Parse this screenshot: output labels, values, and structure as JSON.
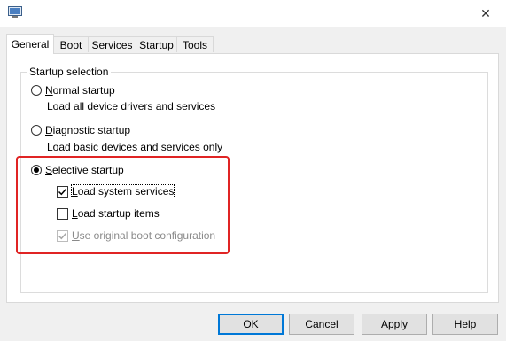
{
  "window": {
    "app_icon": "msconfig-icon",
    "close_glyph": "✕"
  },
  "tabs": [
    {
      "label": "General",
      "active": true
    },
    {
      "label": "Boot"
    },
    {
      "label": "Services"
    },
    {
      "label": "Startup"
    },
    {
      "label": "Tools"
    }
  ],
  "startup_selection": {
    "title": "Startup selection",
    "normal": {
      "label_mnemonic": "N",
      "label_rest": "ormal startup",
      "description": "Load all device drivers and services",
      "selected": false
    },
    "diagnostic": {
      "label_mnemonic": "D",
      "label_rest": "iagnostic startup",
      "description": "Load basic devices and services only",
      "selected": false
    },
    "selective": {
      "label_mnemonic": "S",
      "label_rest": "elective startup",
      "selected": true,
      "options": {
        "load_system_services": {
          "mnemonic": "L",
          "rest": "oad system services",
          "checked": true
        },
        "load_startup_items": {
          "mnemonic": "L",
          "rest": "oad startup items",
          "checked": false
        },
        "use_original_boot": {
          "mnemonic": "U",
          "rest": "se original boot configuration",
          "checked": true,
          "disabled": true
        }
      }
    }
  },
  "buttons": {
    "ok": "OK",
    "cancel": "Cancel",
    "apply_mnemonic": "A",
    "apply_rest": "pply",
    "help": "Help"
  },
  "colors": {
    "highlight_box": "#e02424",
    "default_button_border": "#0078d7",
    "window_bg": "#f0f0f0"
  }
}
